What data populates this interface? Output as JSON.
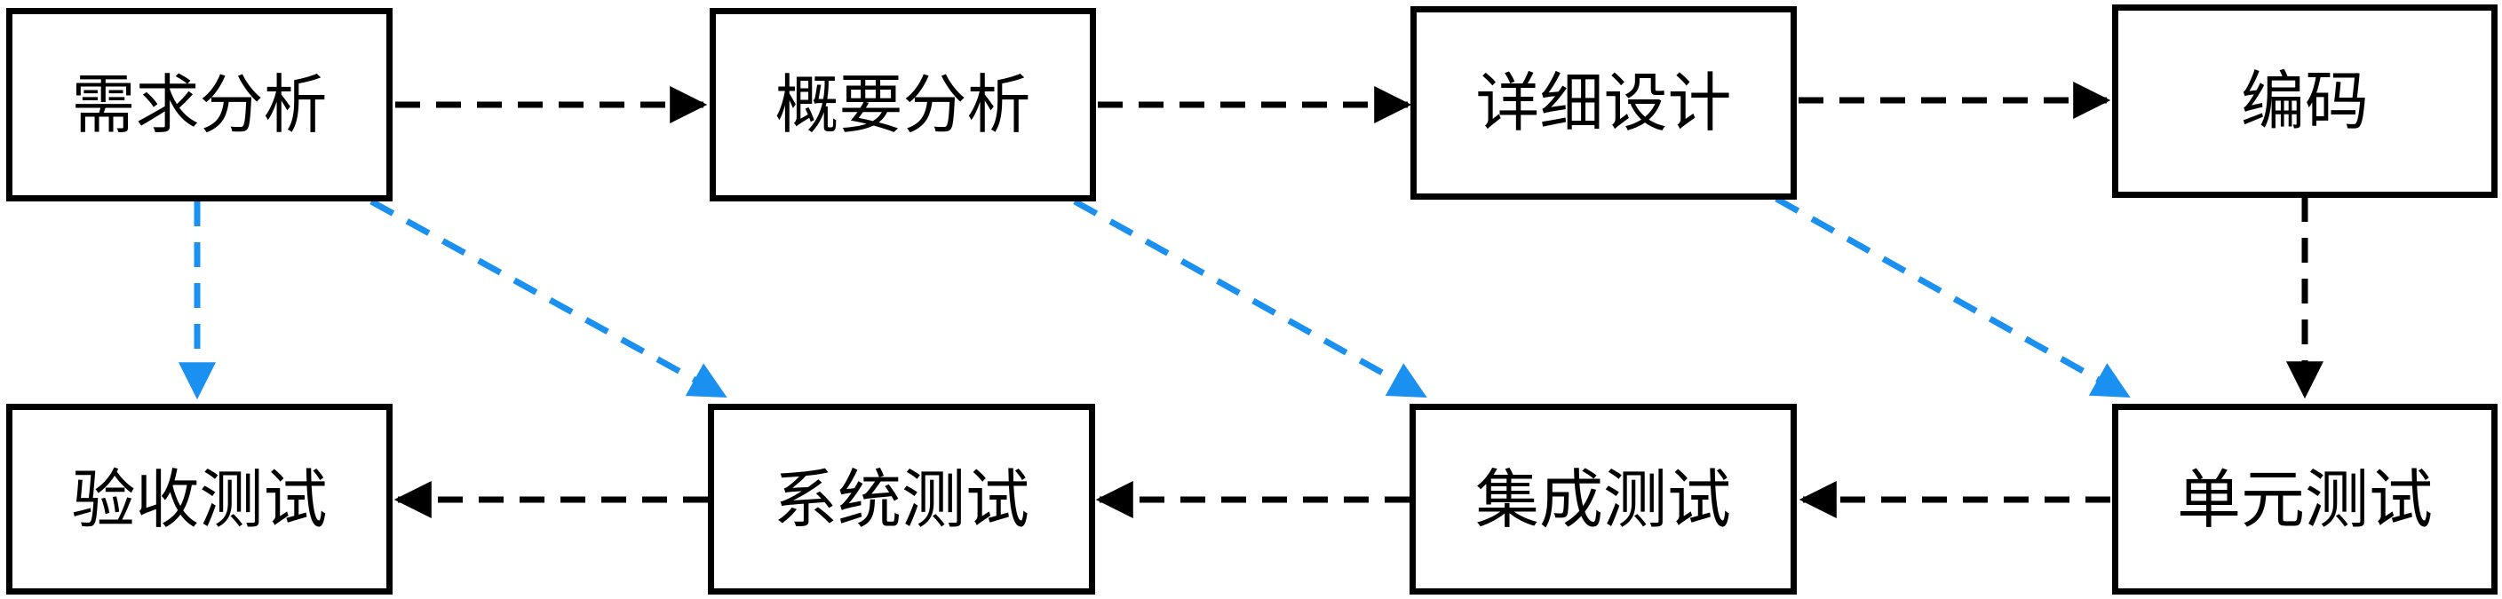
{
  "nodes": {
    "requirements_analysis": "需求分析",
    "outline_design": "概要分析",
    "detailed_design": "详细设计",
    "coding": "编码",
    "acceptance_test": "验收测试",
    "system_test": "系统测试",
    "integration_test": "集成测试",
    "unit_test": "单元测试"
  },
  "edges": [
    {
      "from": "requirements_analysis",
      "to": "outline_design",
      "style": "dashed",
      "color": "#000000"
    },
    {
      "from": "outline_design",
      "to": "detailed_design",
      "style": "dashed",
      "color": "#000000"
    },
    {
      "from": "detailed_design",
      "to": "coding",
      "style": "dashed",
      "color": "#000000"
    },
    {
      "from": "coding",
      "to": "unit_test",
      "style": "dashed",
      "color": "#000000"
    },
    {
      "from": "unit_test",
      "to": "integration_test",
      "style": "dashed",
      "color": "#000000"
    },
    {
      "from": "integration_test",
      "to": "system_test",
      "style": "dashed",
      "color": "#000000"
    },
    {
      "from": "system_test",
      "to": "acceptance_test",
      "style": "dashed",
      "color": "#000000"
    },
    {
      "from": "requirements_analysis",
      "to": "acceptance_test",
      "style": "dashed",
      "color": "#1a90f0"
    },
    {
      "from": "requirements_analysis",
      "to": "system_test",
      "style": "dashed",
      "color": "#1a90f0"
    },
    {
      "from": "outline_design",
      "to": "integration_test",
      "style": "dashed",
      "color": "#1a90f0"
    },
    {
      "from": "detailed_design",
      "to": "unit_test",
      "style": "dashed",
      "color": "#1a90f0"
    }
  ],
  "colors": {
    "flow": "#000000",
    "verification": "#1a90f0"
  }
}
